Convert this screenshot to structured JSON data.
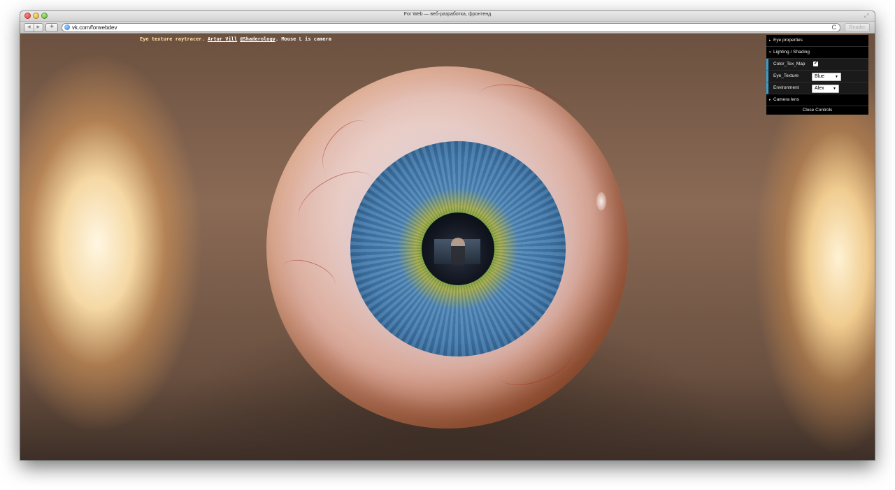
{
  "window": {
    "title": "For Web — веб-разработка, фронтенд"
  },
  "toolbar": {
    "back_glyph": "◀",
    "forward_glyph": "▶",
    "add_glyph": "+",
    "url": "vk.com/forwebdev",
    "reload_glyph": "C",
    "reader_label": "Reader"
  },
  "caption": {
    "prefix": "Eye texture raytracer. ",
    "author": "Artur Vill",
    "separator": " ",
    "handle": "@Shaderology",
    "suffix": ". Mouse L is camera"
  },
  "gui": {
    "folders": {
      "eye_properties": "Eye properties",
      "lighting_shading": "Lighting / Shading",
      "camera_lens": "Camera lens"
    },
    "controls": {
      "color_tex_map": {
        "label": "Color_Tex_Map",
        "checked": true,
        "check_glyph": "✔"
      },
      "eye_texture": {
        "label": "Eye_Texture",
        "value": "Blue"
      },
      "environment": {
        "label": "Environment",
        "value": "Alex"
      }
    },
    "close_label": "Close Controls",
    "collapsed_glyph": "▸",
    "expanded_glyph": "▾",
    "caret_glyph": "▼",
    "accent_color": "#2fa1d6"
  },
  "icons": {
    "traffic_lights": [
      "close-icon",
      "minimize-icon",
      "zoom-icon"
    ],
    "fullscreen": "fullscreen-icon",
    "globe": "globe-icon",
    "reload": "reload-icon"
  }
}
